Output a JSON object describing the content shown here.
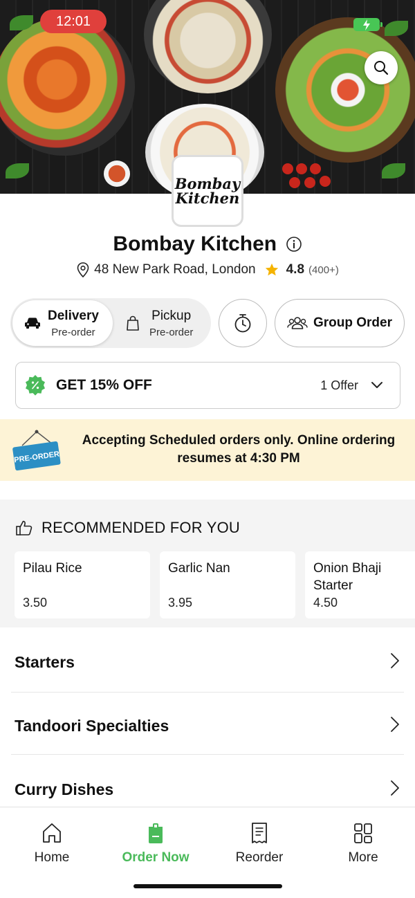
{
  "status_bar": {
    "time": "12:01"
  },
  "restaurant": {
    "logo_text_line1": "Bombay",
    "logo_text_line2": "Kitchen",
    "name": "Bombay Kitchen",
    "address": "48 New Park Road, London",
    "rating": "4.8",
    "rating_count": "(400+)"
  },
  "order_modes": {
    "delivery": {
      "label": "Delivery",
      "sub": "Pre-order"
    },
    "pickup": {
      "label": "Pickup",
      "sub": "Pre-order"
    },
    "selected": "delivery"
  },
  "group_order_label": "Group Order",
  "offer": {
    "title": "GET 15% OFF",
    "count": "1 Offer"
  },
  "banner": {
    "sign_text": "PRE-ORDER",
    "message": "Accepting Scheduled orders only. Online ordering resumes at 4:30 PM"
  },
  "recommended": {
    "heading": "RECOMMENDED FOR YOU",
    "items": [
      {
        "name": "Pilau Rice",
        "price": "3.50"
      },
      {
        "name": "Garlic Nan",
        "price": "3.95"
      },
      {
        "name": "Onion Bhaji Starter",
        "price": "4.50"
      }
    ]
  },
  "categories": [
    "Starters",
    "Tandoori Specialties",
    "Curry Dishes"
  ],
  "nav": {
    "items": [
      {
        "label": "Home",
        "icon": "home-icon"
      },
      {
        "label": "Order Now",
        "icon": "order-icon"
      },
      {
        "label": "Reorder",
        "icon": "receipt-icon"
      },
      {
        "label": "More",
        "icon": "grid-icon"
      }
    ],
    "active": "Order Now"
  },
  "colors": {
    "accent_green": "#4aba5a",
    "time_pill": "#e0403c",
    "banner_bg": "#fdf3d6",
    "preorder_sign": "#2c8fc4"
  }
}
